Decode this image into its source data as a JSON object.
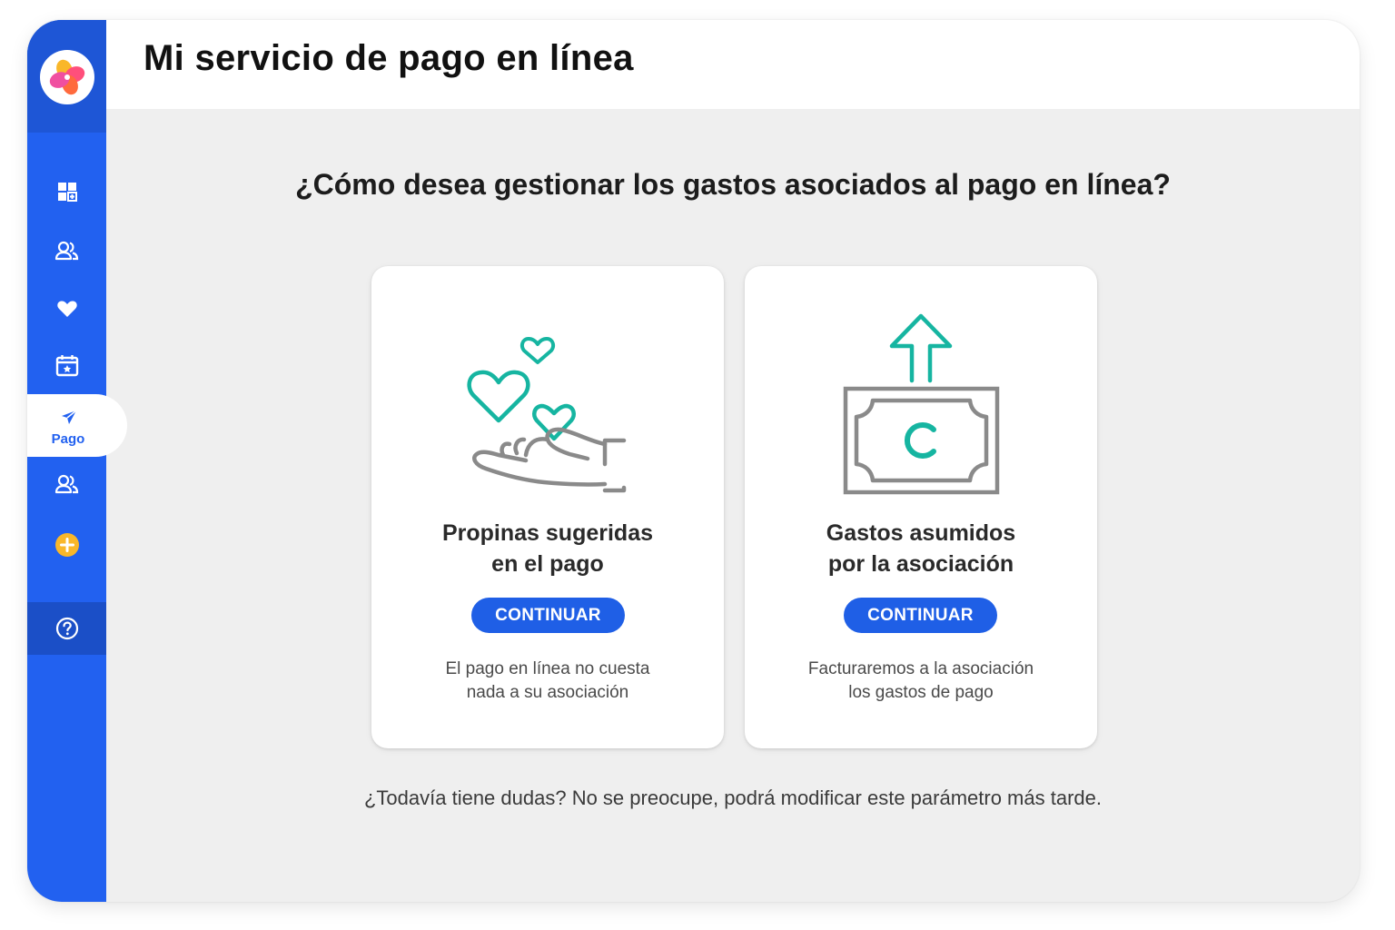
{
  "header": {
    "title": "Mi servicio de pago en línea"
  },
  "sidebar": {
    "items": [
      {
        "icon": "dashboard-icon"
      },
      {
        "icon": "users-icon"
      },
      {
        "icon": "heart-icon"
      },
      {
        "icon": "calendar-icon"
      },
      {
        "icon": "payment-send-icon",
        "label": "Pago",
        "active": true
      },
      {
        "icon": "members-icon"
      },
      {
        "icon": "add-circle-icon"
      },
      {
        "icon": "help-icon"
      }
    ]
  },
  "main": {
    "question": "¿Cómo desea gestionar los gastos asociados al pago en línea?",
    "cards": [
      {
        "icon": "hand-hearts-icon",
        "title_line1": "Propinas sugeridas",
        "title_line2": "en el pago",
        "button": "CONTINUAR",
        "desc_line1": "El pago en línea no cuesta",
        "desc_line2": "nada a su asociación"
      },
      {
        "icon": "money-bill-arrow-icon",
        "title_line1": "Gastos asumidos",
        "title_line2": "por la asociación",
        "button": "CONTINUAR",
        "desc_line1": "Facturaremos a la asociación",
        "desc_line2": "los gastos de pago"
      }
    ],
    "footnote": "¿Todavía tiene dudas? No se preocupe, podrá modificar este parámetro más tarde."
  },
  "colors": {
    "sidebar": "#2261f0",
    "button": "#1f5fe6",
    "teal": "#16b5a1",
    "gray_line": "#8a8a8a",
    "accent_yellow": "#f9b72a"
  }
}
